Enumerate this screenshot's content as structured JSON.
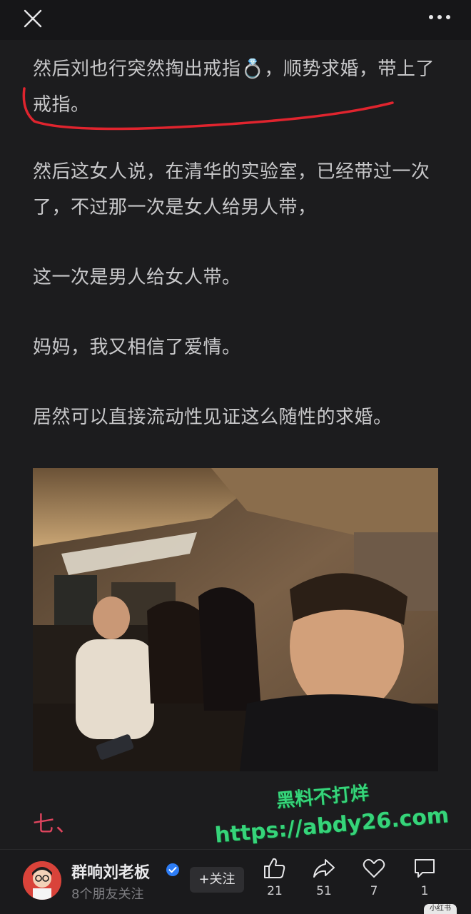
{
  "topbar": {
    "close_icon": "close-icon",
    "more_icon": "more-horizontal-icon"
  },
  "article": {
    "paragraphs": [
      "然后刘也行突然掏出戒指💍，顺势求婚，带上了戒指。",
      "然后这女人说，在清华的实验室，已经带过一次了，不过那一次是女人给男人带，",
      "这一次是男人给女人带。",
      "妈妈，我又相信了爱情。",
      "居然可以直接流动性见证这么随性的求婚。"
    ],
    "highlight_color": "#e0242e",
    "section_heading": "七、",
    "section_heading_color": "#e0455e"
  },
  "watermark": {
    "line1": "黑料不打烊",
    "line2": "https://abdy26.com",
    "color": "#36d47a"
  },
  "bottombar": {
    "author_name": "群响刘老板",
    "author_sub": "8个朋友关注",
    "verified_icon": "verified-badge-icon",
    "follow_label": "+关注",
    "actions": [
      {
        "icon": "thumbs-up-icon",
        "count": "21"
      },
      {
        "icon": "share-icon",
        "count": "51"
      },
      {
        "icon": "heart-icon",
        "count": "7"
      },
      {
        "icon": "comment-icon",
        "count": "1"
      }
    ],
    "corner_badge": "小红书"
  }
}
